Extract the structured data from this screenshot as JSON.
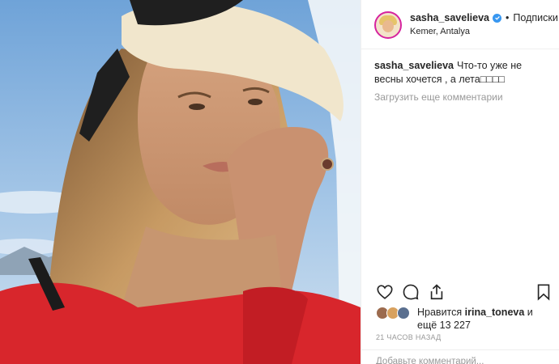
{
  "post": {
    "username": "sasha_savelieva",
    "separator": "•",
    "follow_label": "Подписки",
    "location": "Kemer, Antalya",
    "caption_user": "sasha_savelieva",
    "caption_text": "Что-то уже не весны хочется , а лета□□□□",
    "load_more": "Загрузить еще комментарии",
    "likes_prefix": "Нравится",
    "likes_user": "irina_toneva",
    "likes_suffix": "и ещё 13 227",
    "time": "21 ЧАСОВ НАЗАД",
    "add_comment_placeholder": "Добавьте комментарий..."
  },
  "icons": [
    "heart-icon",
    "comment-icon",
    "share-icon",
    "bookmark-icon",
    "verified-badge-icon"
  ],
  "colors": {
    "text": "#262626",
    "muted": "#999999",
    "verified": "#3897f0",
    "border": "#efefef"
  }
}
